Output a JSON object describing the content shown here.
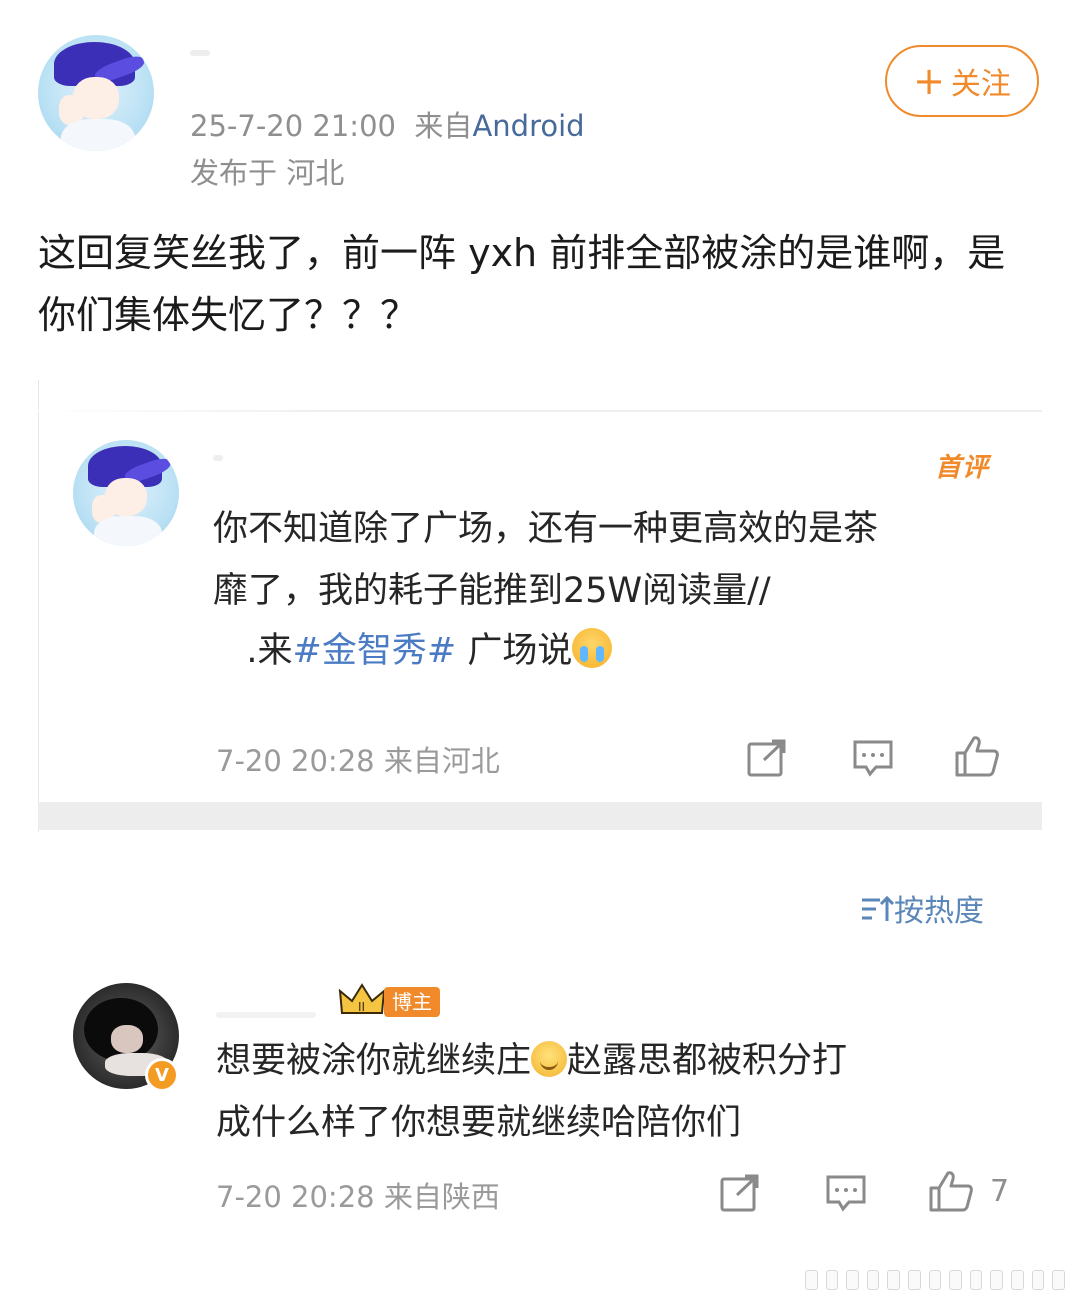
{
  "post": {
    "timestamp": "25-7-20 21:00",
    "source_prefix": "来自",
    "source": "Android",
    "location": "发布于 河北",
    "follow_label": "关注",
    "text": "这回复笑丝我了，前一阵 yxh 前排全部被涂的是谁啊，是你们集体失忆了？？？"
  },
  "quoted_comment": {
    "badge": "首评",
    "text_line1": "你不知道除了广场，还有一种更高效的是茶",
    "text_line2": "靡了，我的耗子能推到25W阅读量//",
    "text_line3_prefix": ".来",
    "hashtag": "#金智秀#",
    "text_line3_suffix": " 广场说",
    "meta": "7-20 20:28 来自河北"
  },
  "sort": {
    "label": "按热度"
  },
  "reply_comment": {
    "badge": "博主",
    "text_line1_a": "想要被涂你就继续庄",
    "text_line1_b": "赵露思都被积分打",
    "text_line2": "成什么样了你想要就继续哈陪你们",
    "meta": "7-20 20:28 来自陕西",
    "like_count": "7"
  },
  "icons": [
    "share-icon",
    "comment-icon",
    "like-icon",
    "sort-icon",
    "verified-icon",
    "crown-icon"
  ],
  "colors": {
    "accent_orange": "#f08a2b",
    "link_blue": "#466a9a",
    "hashtag_blue": "#4a7bc4"
  }
}
